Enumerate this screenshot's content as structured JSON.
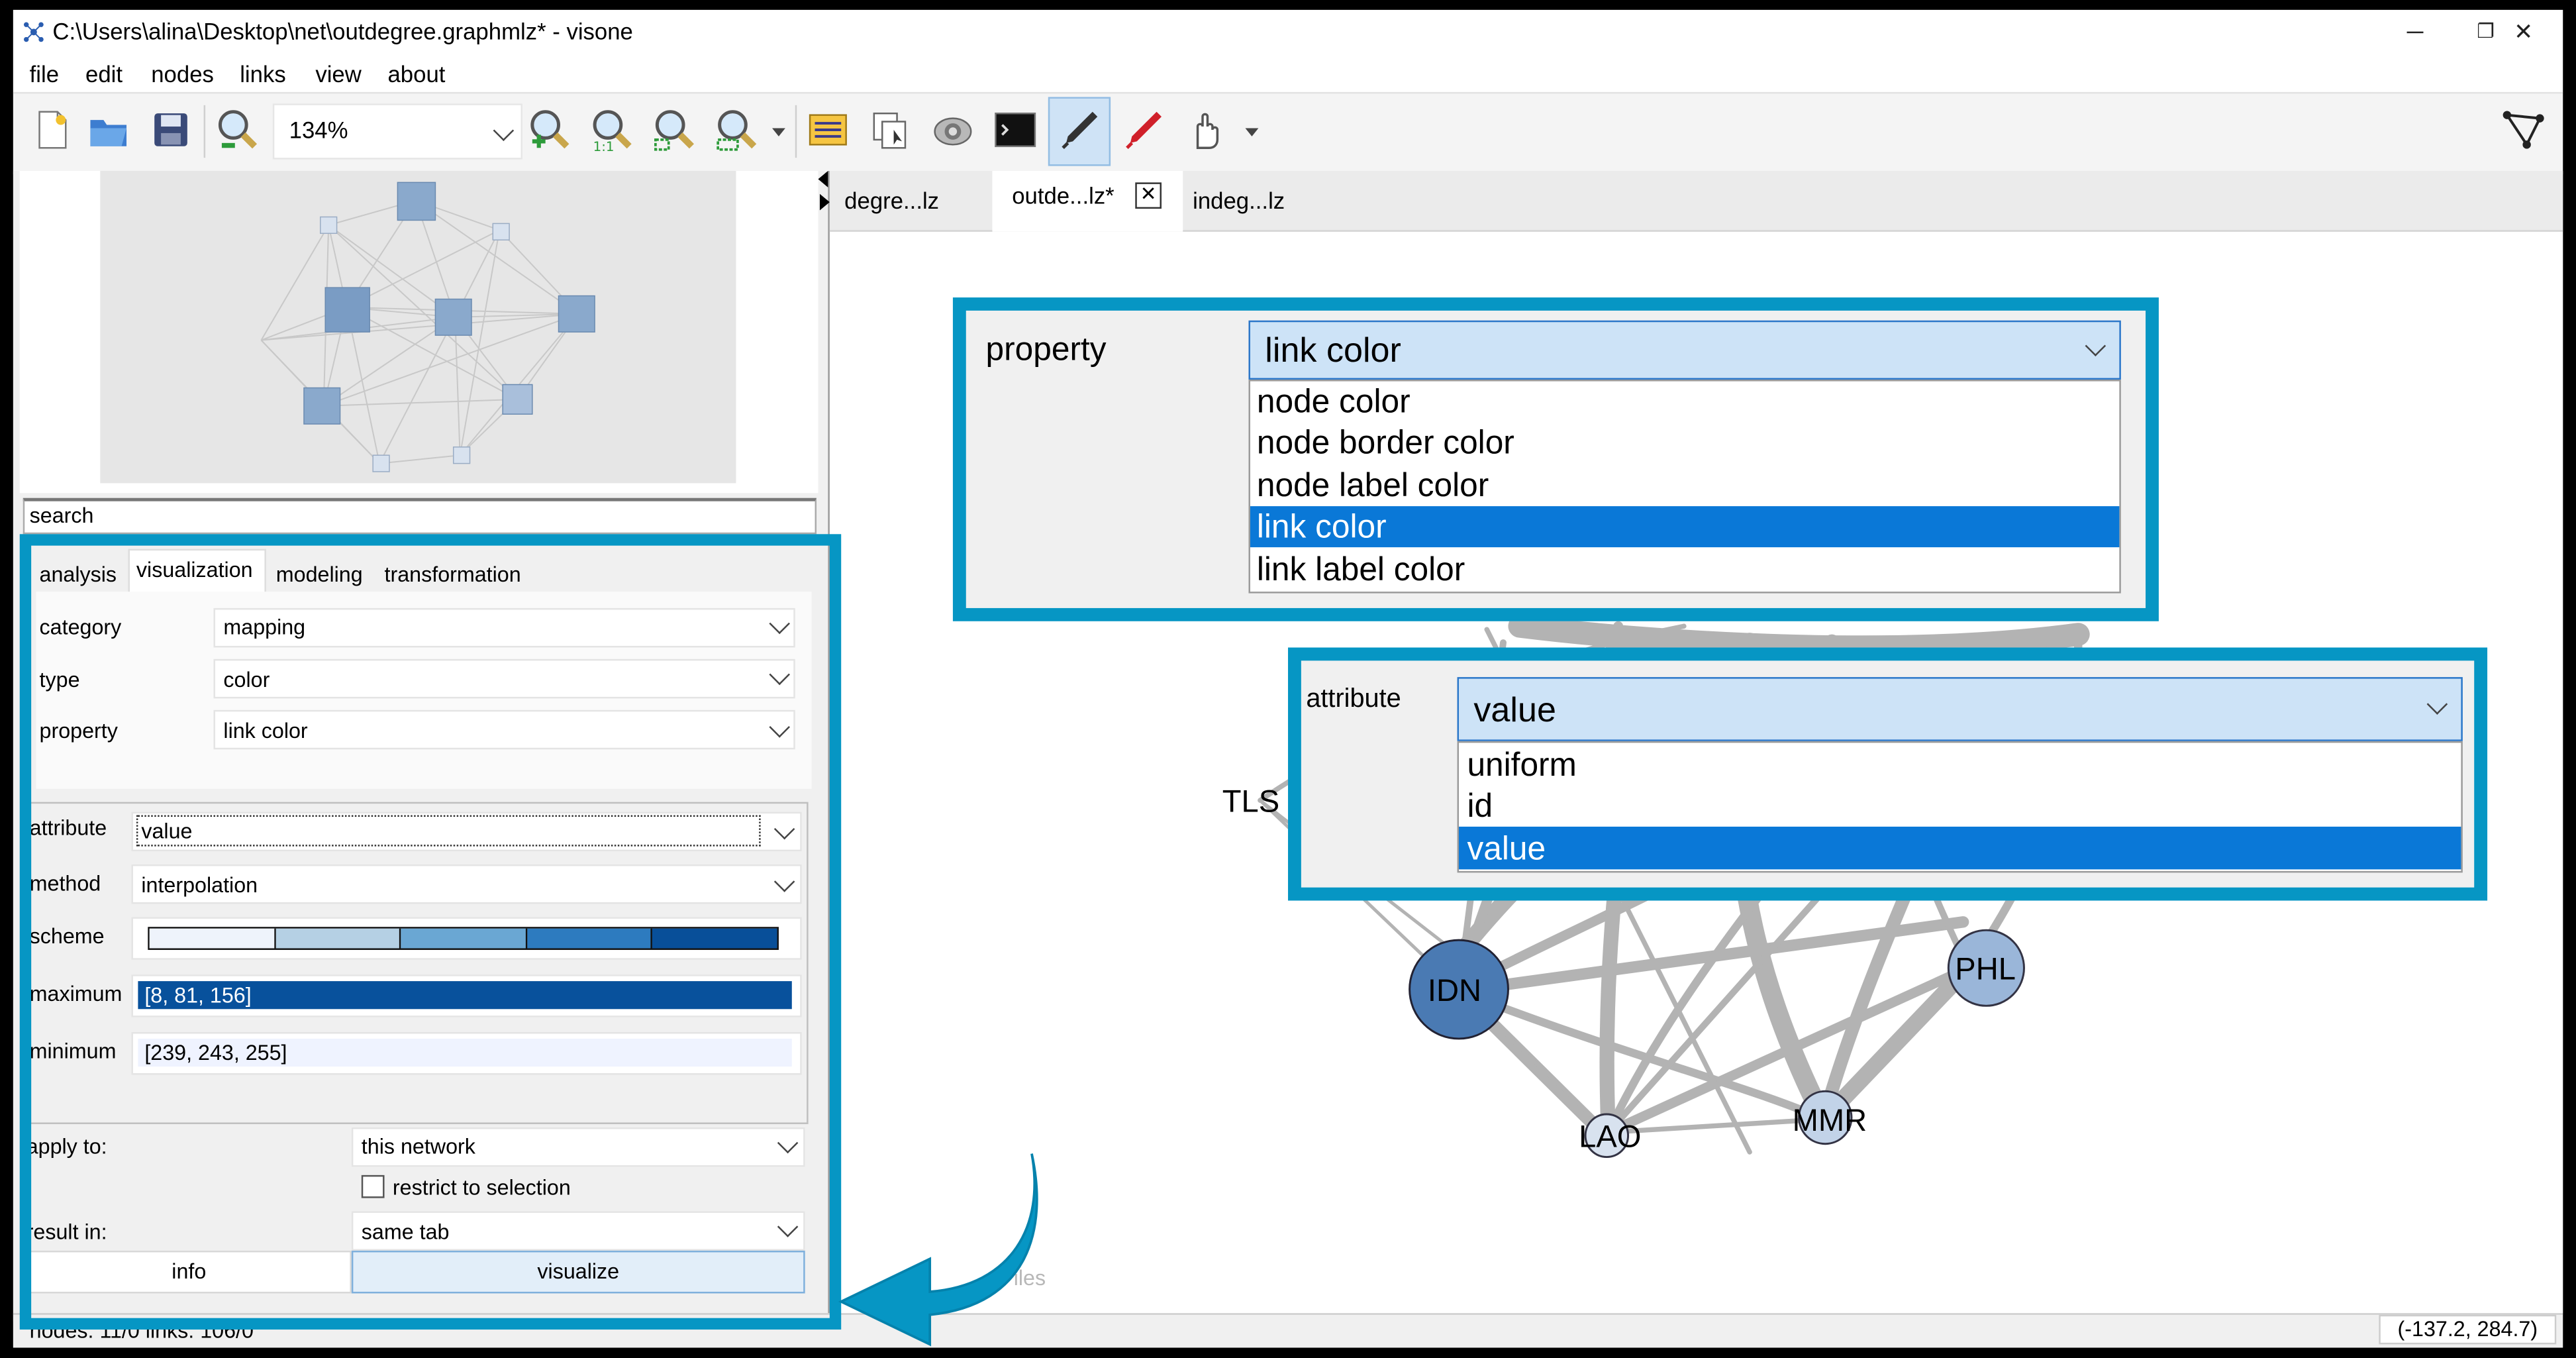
{
  "window": {
    "title": "C:\\Users\\alina\\Desktop\\net\\outdegree.graphmlz* - visone",
    "controls": {
      "minimize": "─",
      "maximize": "❐",
      "close": "✕"
    }
  },
  "menu": {
    "items": [
      "file",
      "edit",
      "nodes",
      "links",
      "view",
      "about"
    ]
  },
  "toolbar": {
    "zoom_value": "134%",
    "icons": [
      "new-file-icon",
      "open-folder-icon",
      "save-icon",
      "zoom-out-icon",
      "zoom-in-icon",
      "zoom-1to1-icon",
      "zoom-fit-icon",
      "zoom-selection-icon",
      "list-icon",
      "copy-select-icon",
      "camera-icon",
      "console-icon",
      "pen-icon",
      "marker-icon",
      "hand-pointer-icon",
      "network-icon"
    ]
  },
  "search": {
    "label": "search"
  },
  "panel": {
    "tabs": [
      "analysis",
      "visualization",
      "modeling",
      "transformation"
    ],
    "active_tab": "visualization",
    "rows": {
      "category": {
        "label": "category",
        "value": "mapping"
      },
      "type": {
        "label": "type",
        "value": "color"
      },
      "property": {
        "label": "property",
        "value": "link color"
      }
    },
    "attribute": {
      "label": "attribute",
      "value": "value"
    },
    "method": {
      "label": "method",
      "value": "interpolation"
    },
    "scheme": {
      "label": "scheme",
      "colors": [
        "#eef3fb",
        "#b5d0e4",
        "#6aa7d3",
        "#2d7bbf",
        "#084f99"
      ]
    },
    "maximum": {
      "label": "maximum",
      "value": "[8, 81, 156]",
      "color": "#08519c"
    },
    "minimum": {
      "label": "minimum",
      "value": "[239, 243, 255]",
      "color": "#eff3ff"
    },
    "apply_to": {
      "label": "apply to:",
      "value": "this network"
    },
    "restrict": {
      "label": "restrict to selection",
      "checked": false
    },
    "result_in": {
      "label": "result in:",
      "value": "same tab"
    },
    "buttons": {
      "info": "info",
      "visualize": "visualize"
    }
  },
  "doc_tabs": [
    {
      "label": "degre...lz",
      "active": false
    },
    {
      "label": "outde...lz*",
      "active": true
    },
    {
      "label": "indeg...lz",
      "active": false
    }
  ],
  "property_popup": {
    "label": "property",
    "selected": "link color",
    "options": [
      "node color",
      "node border color",
      "node label color",
      "link color",
      "link label color"
    ]
  },
  "attribute_popup": {
    "label": "attribute",
    "selected": "value",
    "options": [
      "uniform",
      "id",
      "value"
    ]
  },
  "graph_nodes": [
    {
      "label": "TLS"
    },
    {
      "label": "IDN"
    },
    {
      "label": "PHL"
    },
    {
      "label": "LAO"
    },
    {
      "label": "MMR"
    }
  ],
  "status": {
    "nodes_links": "nodes: 11/0 links: 106/0",
    "coords": "(-137.2, 284.7)"
  },
  "watermark": "iles",
  "colors": {
    "accent": "#0696c4",
    "selection": "#0a78d7",
    "node_dark": "#4a7ab3",
    "node_light": "#9ab6d9"
  }
}
